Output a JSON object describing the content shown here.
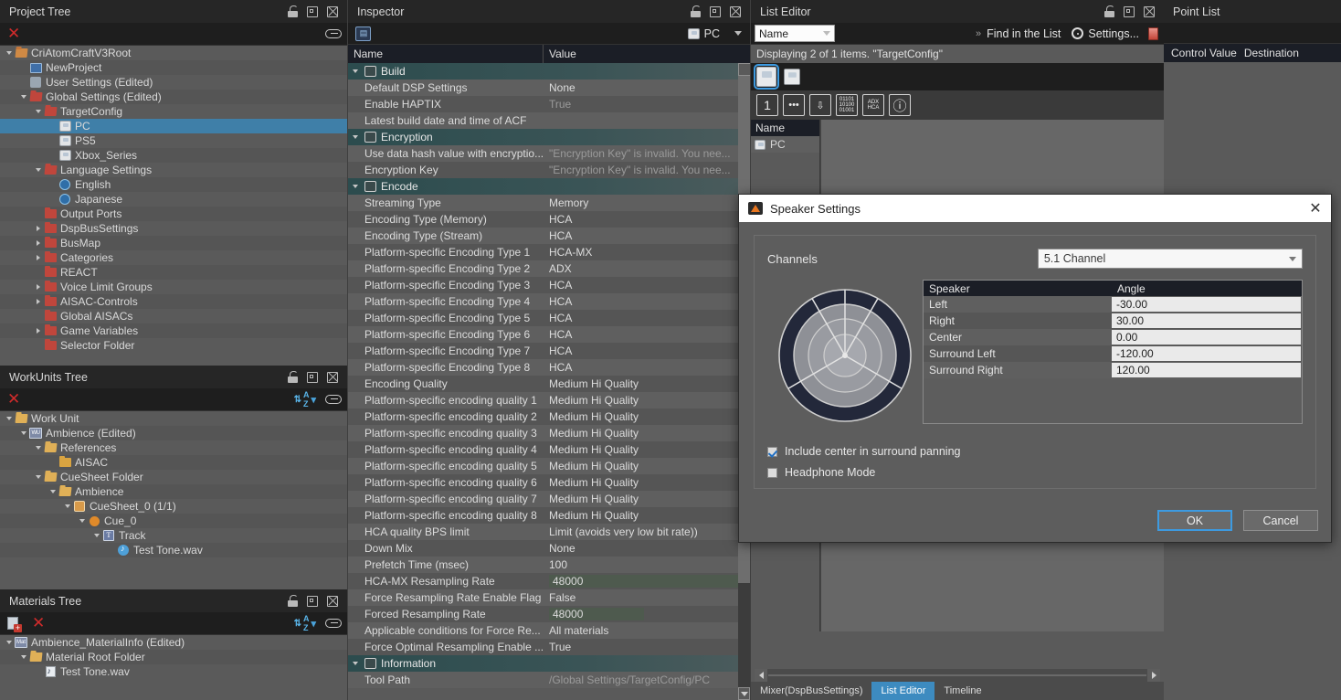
{
  "panels": {
    "project_tree": {
      "title": "Project Tree"
    },
    "workunits_tree": {
      "title": "WorkUnits Tree"
    },
    "materials_tree": {
      "title": "Materials Tree"
    },
    "inspector": {
      "title": "Inspector",
      "target": "PC",
      "col_name": "Name",
      "col_value": "Value"
    },
    "list_editor": {
      "title": "List Editor",
      "filter_value": "Name",
      "find_label": "Find in the List",
      "settings_label": "Settings...",
      "status": "Displaying 2 of 1 items. \"TargetConfig\"",
      "name_header": "Name",
      "name_row": "PC"
    },
    "point_list": {
      "title": "Point List",
      "col_control_value": "Control Value",
      "col_destination": "Destination"
    }
  },
  "project_tree": [
    {
      "label": "CriAtomCraftV3Root",
      "depth": 0,
      "twisty": "open",
      "icon": "folder-open-orange"
    },
    {
      "label": "NewProject",
      "depth": 1,
      "twisty": "none",
      "icon": "project"
    },
    {
      "label": "User Settings (Edited)",
      "depth": 1,
      "twisty": "none",
      "icon": "gear"
    },
    {
      "label": "Global Settings (Edited)",
      "depth": 1,
      "twisty": "open",
      "icon": "folder-open-red"
    },
    {
      "label": "TargetConfig",
      "depth": 2,
      "twisty": "open",
      "icon": "folder-open-red"
    },
    {
      "label": "PC",
      "depth": 3,
      "twisty": "none",
      "icon": "disc",
      "selected": true
    },
    {
      "label": "PS5",
      "depth": 3,
      "twisty": "none",
      "icon": "disc"
    },
    {
      "label": "Xbox_Series",
      "depth": 3,
      "twisty": "none",
      "icon": "disc"
    },
    {
      "label": "Language Settings",
      "depth": 2,
      "twisty": "open",
      "icon": "folder-open-red"
    },
    {
      "label": "English",
      "depth": 3,
      "twisty": "none",
      "icon": "globe"
    },
    {
      "label": "Japanese",
      "depth": 3,
      "twisty": "none",
      "icon": "globe"
    },
    {
      "label": "Output Ports",
      "depth": 2,
      "twisty": "none",
      "icon": "folder-red"
    },
    {
      "label": "DspBusSettings",
      "depth": 2,
      "twisty": "closed",
      "icon": "folder-red"
    },
    {
      "label": "BusMap",
      "depth": 2,
      "twisty": "closed",
      "icon": "folder-red"
    },
    {
      "label": "Categories",
      "depth": 2,
      "twisty": "closed",
      "icon": "folder-red"
    },
    {
      "label": "REACT",
      "depth": 2,
      "twisty": "none",
      "icon": "folder-red"
    },
    {
      "label": "Voice Limit Groups",
      "depth": 2,
      "twisty": "closed",
      "icon": "folder-red"
    },
    {
      "label": "AISAC-Controls",
      "depth": 2,
      "twisty": "closed",
      "icon": "folder-red"
    },
    {
      "label": "Global AISACs",
      "depth": 2,
      "twisty": "none",
      "icon": "folder-red"
    },
    {
      "label": "Game Variables",
      "depth": 2,
      "twisty": "closed",
      "icon": "folder-red"
    },
    {
      "label": "Selector Folder",
      "depth": 2,
      "twisty": "none",
      "icon": "folder-red"
    }
  ],
  "workunits_tree": [
    {
      "label": "Work Unit",
      "depth": 0,
      "twisty": "open",
      "icon": "folder-open-yellow"
    },
    {
      "label": "Ambience (Edited)",
      "depth": 1,
      "twisty": "open",
      "icon": "workunit"
    },
    {
      "label": "References",
      "depth": 2,
      "twisty": "open",
      "icon": "folder-open-yellow"
    },
    {
      "label": "AISAC",
      "depth": 3,
      "twisty": "none",
      "icon": "folder-yellow"
    },
    {
      "label": "CueSheet Folder",
      "depth": 2,
      "twisty": "open",
      "icon": "folder-open-yellow"
    },
    {
      "label": "Ambience",
      "depth": 3,
      "twisty": "open",
      "icon": "folder-open-yellow"
    },
    {
      "label": "CueSheet_0 (1/1)",
      "depth": 4,
      "twisty": "open",
      "icon": "cuesheet"
    },
    {
      "label": "Cue_0",
      "depth": 5,
      "twisty": "open",
      "icon": "cue"
    },
    {
      "label": "Track",
      "depth": 6,
      "twisty": "open",
      "icon": "track"
    },
    {
      "label": "Test Tone.wav",
      "depth": 7,
      "twisty": "none",
      "icon": "wave"
    }
  ],
  "materials_tree": [
    {
      "label": "Ambience_MaterialInfo (Edited)",
      "depth": 0,
      "twisty": "open",
      "icon": "material-info"
    },
    {
      "label": "Material Root Folder",
      "depth": 1,
      "twisty": "open",
      "icon": "folder-open-yellow"
    },
    {
      "label": "Test Tone.wav",
      "depth": 2,
      "twisty": "none",
      "icon": "wave-file"
    }
  ],
  "inspector_rows": [
    {
      "kind": "group",
      "name": "Build",
      "icon": "build-icon"
    },
    {
      "kind": "prop",
      "name": "Default DSP Settings",
      "value": "None"
    },
    {
      "kind": "prop",
      "name": "Enable HAPTIX",
      "value": "True",
      "dim": true
    },
    {
      "kind": "prop",
      "name": "Latest build date and time of ACF",
      "value": ""
    },
    {
      "kind": "group",
      "name": "Encryption",
      "icon": "encryption-icon"
    },
    {
      "kind": "prop",
      "name": "Use data hash value with encryptio...",
      "value": "\"Encryption Key\" is invalid. You nee...",
      "dim": true
    },
    {
      "kind": "prop",
      "name": "Encryption Key",
      "value": "\"Encryption Key\" is invalid. You nee...",
      "dim": true
    },
    {
      "kind": "group",
      "name": "Encode",
      "icon": "encode-icon"
    },
    {
      "kind": "prop",
      "name": "Streaming Type",
      "value": "Memory"
    },
    {
      "kind": "prop",
      "name": "Encoding Type (Memory)",
      "value": "HCA"
    },
    {
      "kind": "prop",
      "name": "Encoding Type (Stream)",
      "value": "HCA"
    },
    {
      "kind": "prop",
      "name": "Platform-specific Encoding Type 1",
      "value": "HCA-MX"
    },
    {
      "kind": "prop",
      "name": "Platform-specific Encoding Type 2",
      "value": "ADX"
    },
    {
      "kind": "prop",
      "name": "Platform-specific Encoding Type 3",
      "value": "HCA"
    },
    {
      "kind": "prop",
      "name": "Platform-specific Encoding Type 4",
      "value": "HCA"
    },
    {
      "kind": "prop",
      "name": "Platform-specific Encoding Type 5",
      "value": "HCA"
    },
    {
      "kind": "prop",
      "name": "Platform-specific Encoding Type 6",
      "value": "HCA"
    },
    {
      "kind": "prop",
      "name": "Platform-specific Encoding Type 7",
      "value": "HCA"
    },
    {
      "kind": "prop",
      "name": "Platform-specific Encoding Type 8",
      "value": "HCA"
    },
    {
      "kind": "prop",
      "name": "Encoding Quality",
      "value": "Medium Hi Quality"
    },
    {
      "kind": "prop",
      "name": "Platform-specific encoding quality 1",
      "value": "Medium Hi Quality"
    },
    {
      "kind": "prop",
      "name": "Platform-specific encoding quality 2",
      "value": "Medium Hi Quality"
    },
    {
      "kind": "prop",
      "name": "Platform-specific encoding quality 3",
      "value": "Medium Hi Quality"
    },
    {
      "kind": "prop",
      "name": "Platform-specific encoding quality 4",
      "value": "Medium Hi Quality"
    },
    {
      "kind": "prop",
      "name": "Platform-specific encoding quality 5",
      "value": "Medium Hi Quality"
    },
    {
      "kind": "prop",
      "name": "Platform-specific encoding quality 6",
      "value": "Medium Hi Quality"
    },
    {
      "kind": "prop",
      "name": "Platform-specific encoding quality 7",
      "value": "Medium Hi Quality"
    },
    {
      "kind": "prop",
      "name": "Platform-specific encoding quality 8",
      "value": "Medium Hi Quality"
    },
    {
      "kind": "prop",
      "name": "HCA quality BPS limit",
      "value": "Limit (avoids very low bit rate))"
    },
    {
      "kind": "prop",
      "name": "Down Mix",
      "value": "None"
    },
    {
      "kind": "prop",
      "name": "Prefetch Time (msec)",
      "value": "100"
    },
    {
      "kind": "prop",
      "name": "HCA-MX Resampling Rate",
      "value": "48000",
      "boxed": "full"
    },
    {
      "kind": "prop",
      "name": "Force Resampling Rate Enable Flag",
      "value": "False"
    },
    {
      "kind": "prop",
      "name": "Forced Resampling Rate",
      "value": "48000",
      "boxed": "part"
    },
    {
      "kind": "prop",
      "name": "Applicable conditions for Force Re...",
      "value": "All materials"
    },
    {
      "kind": "prop",
      "name": "Force Optimal Resampling Enable ...",
      "value": "True"
    },
    {
      "kind": "group",
      "name": "Information",
      "icon": "information-icon"
    },
    {
      "kind": "prop",
      "name": "Tool Path",
      "value": "/Global Settings/TargetConfig/PC",
      "dim": true
    }
  ],
  "list_editor_tools": [
    "1",
    "comment-icon",
    "import-icon",
    "binary-icon",
    "adx-hca-icon",
    "info-icon"
  ],
  "bottom_tabs": [
    {
      "label": "Mixer(DspBusSettings)",
      "active": false
    },
    {
      "label": "List Editor",
      "active": true
    },
    {
      "label": "Timeline",
      "active": false
    }
  ],
  "dialog": {
    "title": "Speaker Settings",
    "close_label": "✕",
    "channels_label": "Channels",
    "channels_value": "5.1 Channel",
    "table_head": {
      "speaker": "Speaker",
      "angle": "Angle"
    },
    "speakers": [
      {
        "name": "Left",
        "angle": "-30.00"
      },
      {
        "name": "Right",
        "angle": "30.00"
      },
      {
        "name": "Center",
        "angle": "0.00"
      },
      {
        "name": "Surround Left",
        "angle": "-120.00"
      },
      {
        "name": "Surround Right",
        "angle": "120.00"
      }
    ],
    "checkboxes": [
      {
        "label": "Include center in surround panning",
        "checked": true
      },
      {
        "label": "Headphone Mode",
        "checked": false
      }
    ],
    "ok_label": "OK",
    "cancel_label": "Cancel",
    "accent_color": "#3d9ae0",
    "logo_color": "#e8761f"
  },
  "chart_data": {
    "type": "scatter",
    "title": "Speaker angle polar diagram",
    "angles_deg": [
      -30,
      30,
      0,
      -120,
      120
    ],
    "labels": [
      "Left",
      "Right",
      "Center",
      "Surround Left",
      "Surround Right"
    ],
    "rings": [
      0.32,
      0.56,
      0.78,
      1.0
    ],
    "grid": true,
    "legend": "none"
  }
}
